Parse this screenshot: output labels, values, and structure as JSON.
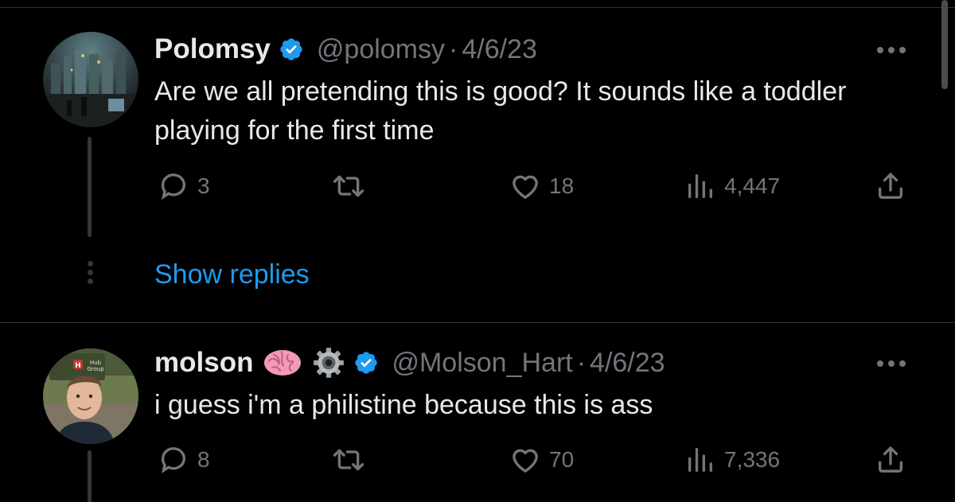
{
  "tweets": [
    {
      "name": "Polomsy",
      "handle": "@polomsy",
      "separator": "·",
      "date": "4/6/23",
      "verified": true,
      "text": "Are we all pretending this is good? It sounds like a toddler playing for the first time",
      "stats": {
        "replies": "3",
        "retweets": "",
        "likes": "18",
        "views": "4,447"
      }
    },
    {
      "name": "molson",
      "name_emoji": [
        "brain",
        "gear"
      ],
      "handle": "@Molson_Hart",
      "separator": "·",
      "date": "4/6/23",
      "verified": true,
      "avatar_sign_text": "Hub Group",
      "text": "i guess i'm a philistine because this is ass",
      "stats": {
        "replies": "8",
        "retweets": "",
        "likes": "70",
        "views": "7,336"
      }
    }
  ],
  "show_replies_label": "Show replies",
  "icons": {
    "reply": "reply-icon",
    "retweet": "retweet-icon",
    "like": "heart-icon",
    "views": "views-icon",
    "share": "share-icon",
    "verified": "verified-badge-icon",
    "more": "more-options-icon"
  },
  "colors": {
    "background": "#000000",
    "text_primary": "#e7e9ea",
    "text_secondary": "#71767b",
    "link": "#1d9bf0",
    "verified": "#1d9bf0",
    "divider": "#2f3336"
  }
}
